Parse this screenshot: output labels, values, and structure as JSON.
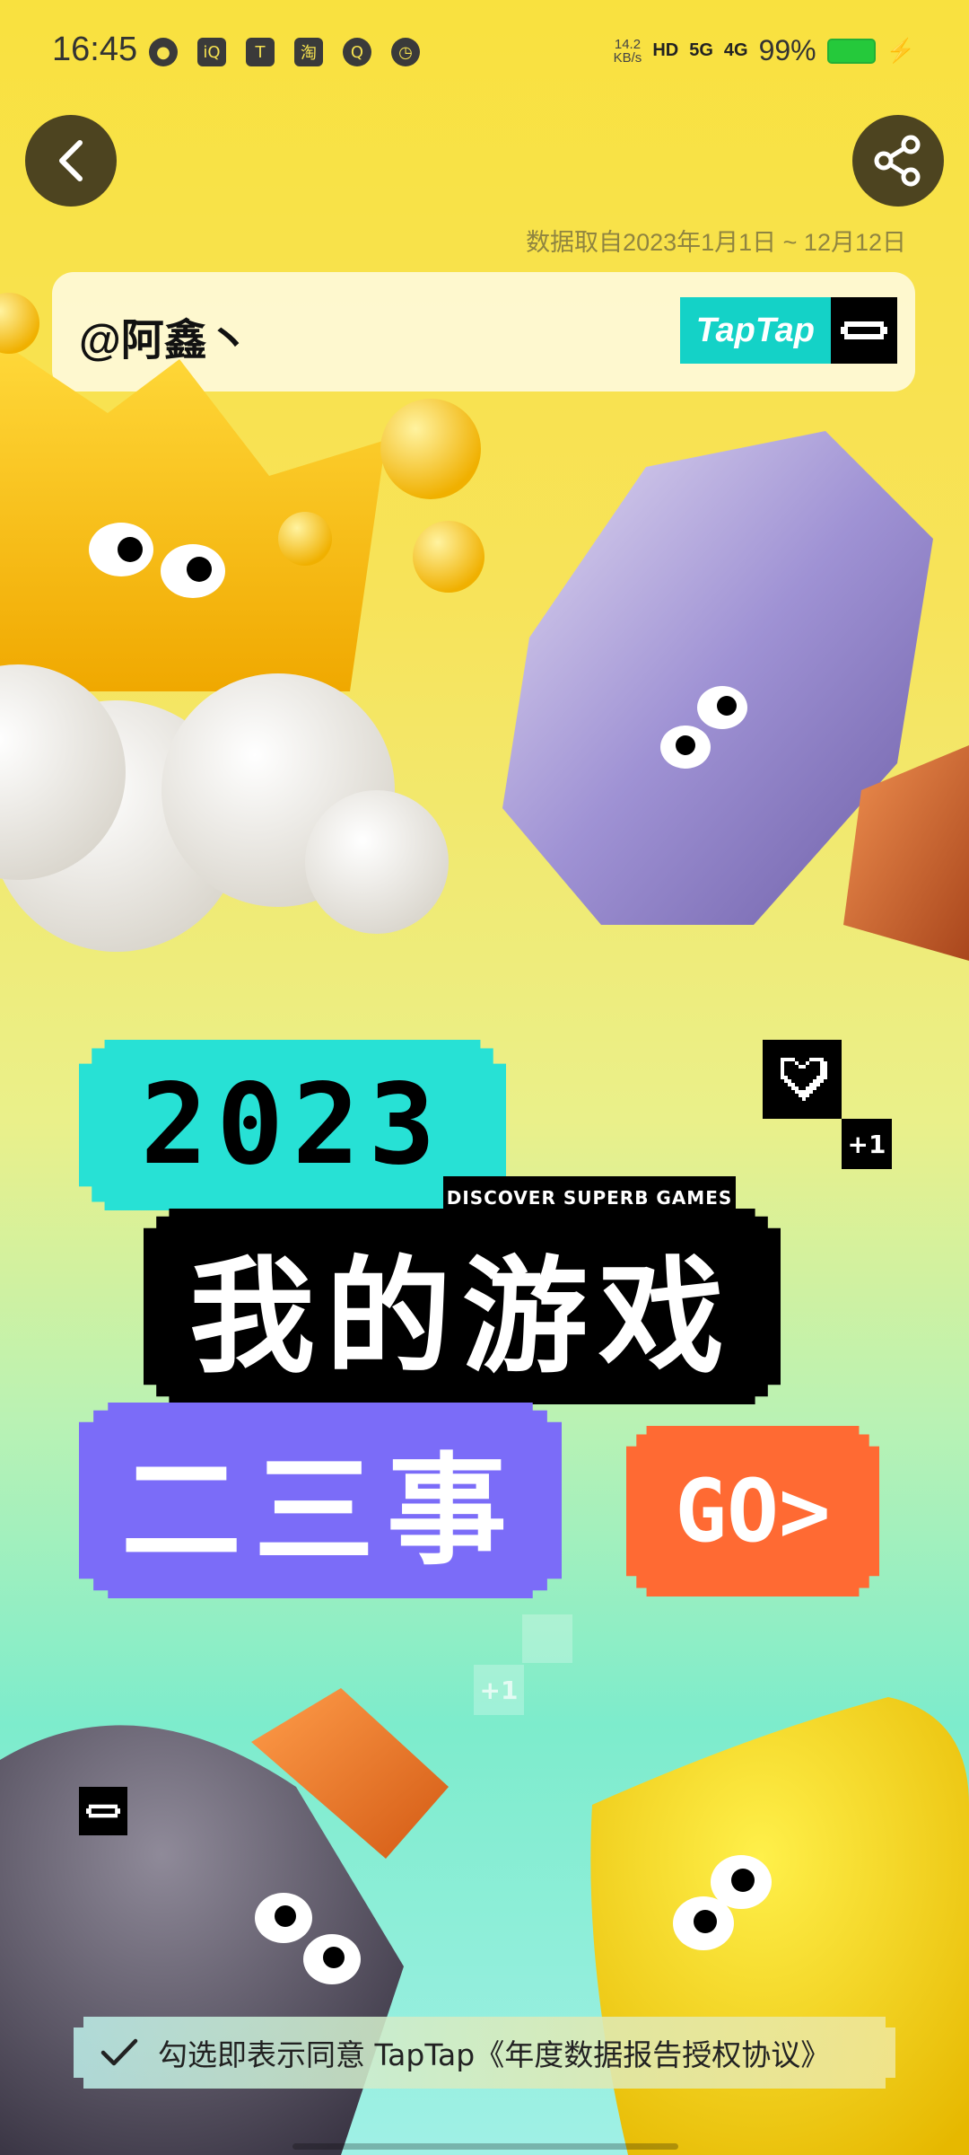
{
  "status_bar": {
    "time": "16:45",
    "left_icons": [
      "app-icon-1",
      "iqiyi-icon",
      "taptap-icon",
      "taobao-icon",
      "q-icon",
      "timer-icon"
    ],
    "net_speed_value": "14.2",
    "net_speed_unit": "KB/s",
    "hd_label": "HD",
    "signal_1": "5G",
    "signal_2": "4G",
    "battery_percent": "99%",
    "battery_color": "#25c93b"
  },
  "header": {
    "back_icon": "chevron-left-icon",
    "share_icon": "share-icon",
    "date_note": "数据取自2023年1月1日 ~ 12月12日"
  },
  "user_card": {
    "username": "@阿鑫丶",
    "logo_text": "TapTap"
  },
  "title": {
    "year": "2023",
    "tag": "DISCOVER SUPERB GAMES",
    "line1": "我的游戏",
    "line2": "二三事",
    "go_label": "GO>",
    "plus_one": "+1",
    "plus_one_faint": "+1"
  },
  "colors": {
    "teal": "#27e1d5",
    "purple": "#7b6cf8",
    "orange": "#ff6a33",
    "yellow": "#f9e13f"
  },
  "agreement": {
    "text": "勾选即表示同意 TapTap《年度数据报告授权协议》",
    "checked": true
  }
}
